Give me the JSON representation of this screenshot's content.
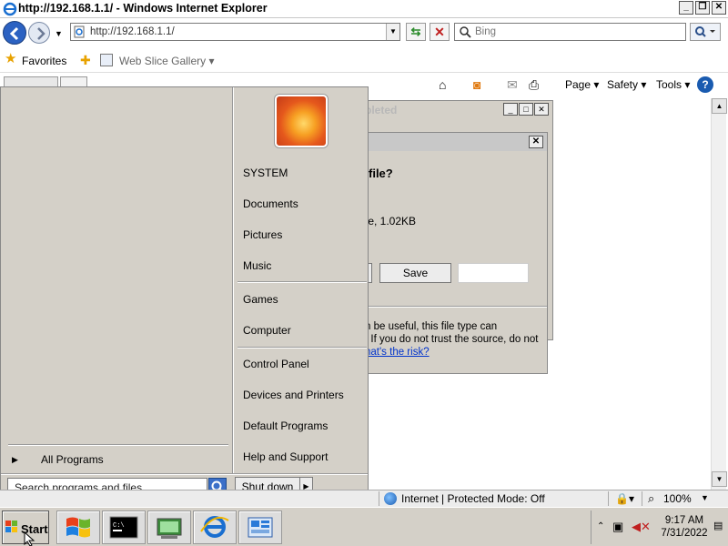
{
  "window": {
    "title": "http://192.168.1.1/ - Windows Internet Explorer",
    "min": "_",
    "max": "❐",
    "close": "✕"
  },
  "address_bar": {
    "url": "http://192.168.1.1/",
    "search_placeholder": "Bing"
  },
  "favorites_bar": {
    "favorites_label": "Favorites",
    "web_slice_label": "Web Slice Gallery ▾"
  },
  "command_bar": {
    "page": "Page ▾",
    "safety": "Safety ▾",
    "tools": "Tools ▾",
    "help": "?"
  },
  "download_progress": {
    "title": "pleted"
  },
  "file_download": {
    "question": "file?",
    "size_text": "te, 1.02KB",
    "save_label": "Save",
    "warning_text": "n be useful, this file type can\n. If you do not trust the source, do not",
    "risk_link": "hat's the risk?"
  },
  "start_menu": {
    "right_items": [
      "SYSTEM",
      "Documents",
      "Pictures",
      "Music",
      "Games",
      "Computer",
      "Control Panel",
      "Devices and Printers",
      "Default Programs",
      "Help and Support"
    ],
    "all_programs": "All Programs",
    "search_placeholder": "Search programs and files",
    "shutdown_label": "Shut down"
  },
  "status_bar": {
    "zone_text": "Internet | Protected Mode: Off",
    "zoom": "100%"
  },
  "taskbar": {
    "start_label": "Start",
    "time": "9:17 AM",
    "date": "7/31/2022"
  }
}
